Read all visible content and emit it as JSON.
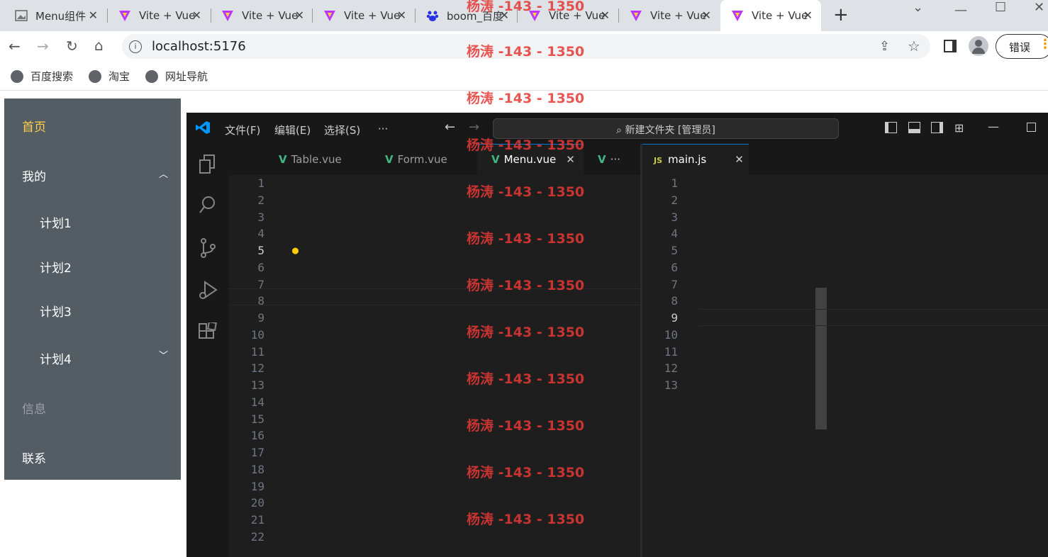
{
  "browser": {
    "tabs": [
      {
        "title": "Menu组件",
        "icon": "picture-icon"
      },
      {
        "title": "Vite + Vue",
        "icon": "vite-icon"
      },
      {
        "title": "Vite + Vue",
        "icon": "vite-icon"
      },
      {
        "title": "Vite + Vue",
        "icon": "vite-icon"
      },
      {
        "title": "boom_百度",
        "icon": "baidu-icon"
      },
      {
        "title": "Vite + Vue",
        "icon": "vite-icon"
      },
      {
        "title": "Vite + Vue",
        "icon": "vite-icon"
      },
      {
        "title": "Vite + Vue",
        "icon": "vite-icon"
      }
    ],
    "url": "localhost:5176",
    "error_label": "错误",
    "bookmarks": [
      "百度搜索",
      "淘宝",
      "网址导航"
    ]
  },
  "watermark": "杨涛 -143 - 1350",
  "app_menu": {
    "items": [
      {
        "label": "首页",
        "color": "#ffd04b"
      },
      {
        "label": "我的"
      },
      {
        "label": "计划1"
      },
      {
        "label": "计划2"
      },
      {
        "label": "计划3"
      },
      {
        "label": "计划4"
      },
      {
        "label": "信息",
        "color": "#9aa0a6"
      },
      {
        "label": "联系"
      }
    ],
    "background": "#545c64"
  },
  "vscode": {
    "menus": [
      "文件(F)",
      "编辑(E)",
      "选择(S)",
      "···"
    ],
    "search": "新建文件夹 [管理员]",
    "left_tabs": [
      "Table.vue",
      "Form.vue",
      "Menu.vue",
      "···"
    ],
    "right_tab": "main.js",
    "js_badge": "JS",
    "left_code_lines": [
      "1",
      "2",
      "3",
      "4",
      "5",
      "6",
      "7",
      "8",
      "9",
      "10",
      "11",
      "12",
      "13",
      "14",
      "15",
      "16",
      "17",
      "18",
      "19",
      "20",
      "21",
      "22"
    ],
    "right_code_lines": [
      "1",
      "2",
      "3",
      "4",
      "5",
      "6",
      "7",
      "8",
      "9",
      "10",
      "11",
      "12",
      "13"
    ]
  }
}
